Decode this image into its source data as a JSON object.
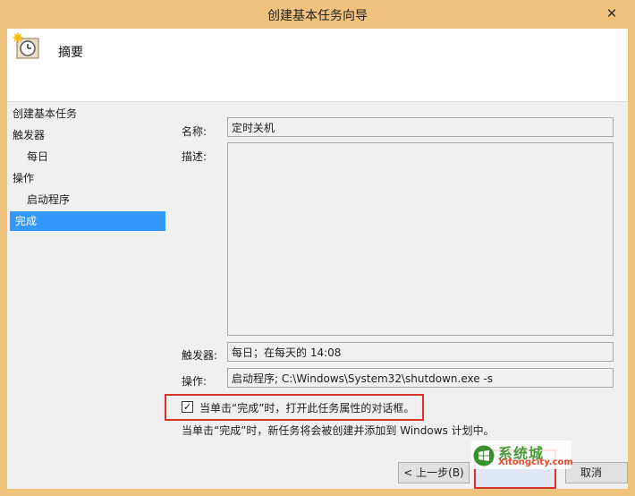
{
  "window": {
    "title": "创建基本任务向导",
    "close_label": "✕"
  },
  "header": {
    "title": "摘要"
  },
  "nav": {
    "items": [
      {
        "label": "创建基本任务"
      },
      {
        "label": "触发器"
      },
      {
        "label": "每日"
      },
      {
        "label": "操作"
      },
      {
        "label": "启动程序"
      },
      {
        "label": "完成"
      }
    ]
  },
  "summary": {
    "name_label": "名称:",
    "name_value": "定时关机",
    "description_label": "描述:",
    "description_value": "",
    "trigger_label": "触发器:",
    "trigger_value": "每日；在每天的 14:08",
    "action_label": "操作:",
    "action_value": "启动程序; C:\\Windows\\System32\\shutdown.exe -s"
  },
  "open_properties": {
    "checked": true,
    "label": "当单击“完成”时，打开此任务属性的对话框。"
  },
  "info_text": "当单击“完成”时，新任务将会被创建并添加到 Windows 计划中。",
  "buttons": {
    "back": "< 上一步(B)",
    "cancel": "取消"
  },
  "watermark": {
    "cn": "系统城",
    "en": "Xitongcity.com"
  },
  "colors": {
    "accent": "#3399ff",
    "highlight": "#d9332c",
    "titlebar": "#f1c27d"
  }
}
